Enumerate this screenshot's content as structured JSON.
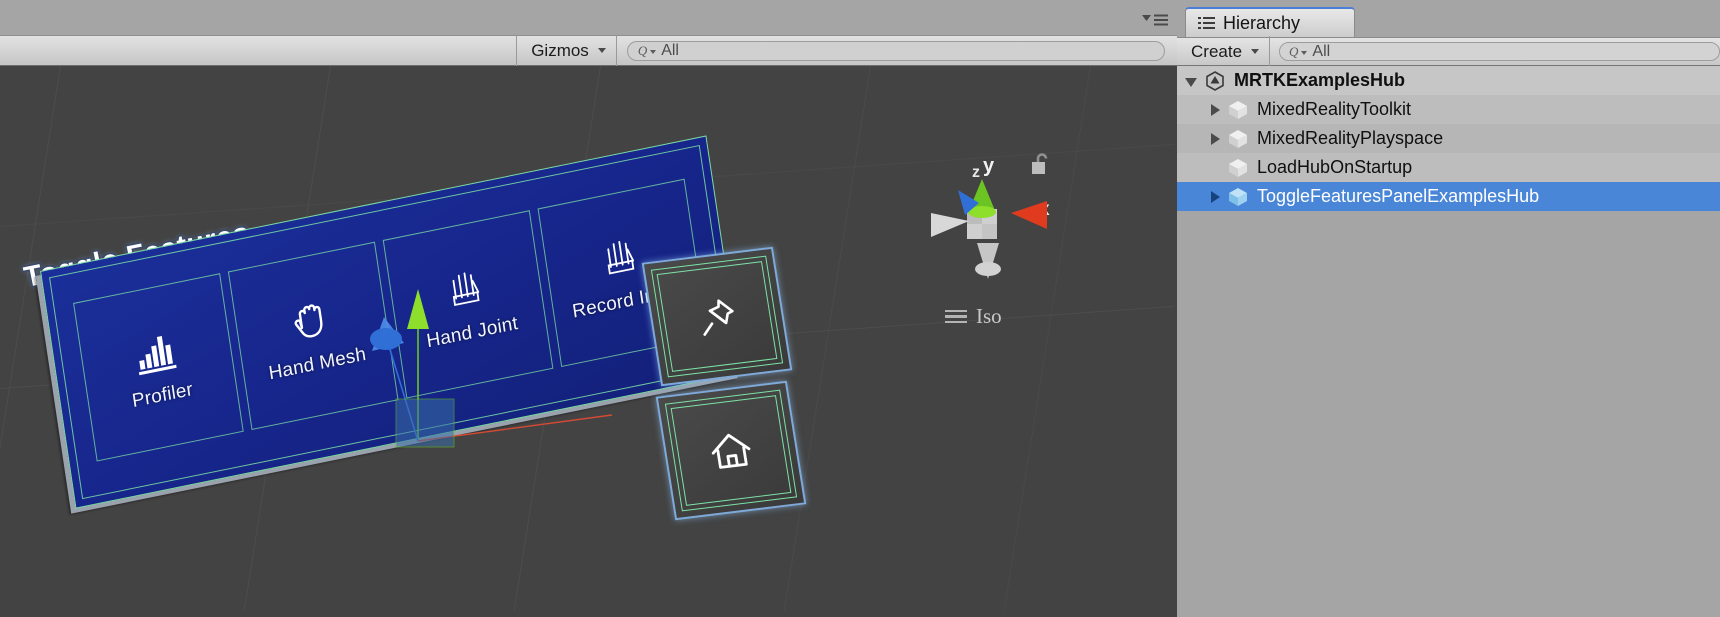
{
  "scene_view": {
    "options_icon": "options-menu-icon",
    "toolbar": {
      "gizmos_label": "Gizmos",
      "search_placeholder": "All",
      "search_icon": "search-icon"
    },
    "overlay": {
      "lock_icon": "unlocked-padlock-icon",
      "view_mode": "Iso",
      "view_mode_icon": "hamburger-icon",
      "axis_labels": {
        "x": "x",
        "y": "y",
        "z": "z"
      },
      "axis_colors": {
        "x": "#e03b1e",
        "y": "#6cc422",
        "z": "#2f6fd6",
        "neutral": "#c8c8c8"
      }
    },
    "background_color": "#434343",
    "grid_color": "#565656"
  },
  "mrtk_scene": {
    "panel_title": "Toggle Features",
    "panel_color": "#16258a",
    "wireframe_color": "#7de2a5",
    "selection_outline_color": "#7fa9d8",
    "buttons": [
      {
        "label": "Profiler",
        "icon": "bar-chart-icon"
      },
      {
        "label": "Hand Mesh",
        "icon": "hand-icon"
      },
      {
        "label": "Hand Joint",
        "icon": "hand-joint-icon"
      },
      {
        "label": "Record Input",
        "icon": "hand-record-icon"
      }
    ],
    "side_buttons": [
      {
        "name": "pin-button",
        "icon": "pin-icon"
      },
      {
        "name": "home-button",
        "icon": "home-icon"
      }
    ]
  },
  "hierarchy": {
    "tab_label": "Hierarchy",
    "tab_icon": "hierarchy-list-icon",
    "create_label": "Create",
    "search_placeholder": "All",
    "search_icon": "search-icon",
    "selection_color": "#4a86d8",
    "items": [
      {
        "label": "MRTKExamplesHub",
        "depth": 0,
        "expanded": true,
        "has_children": true,
        "icon": "unity-logo-icon",
        "selected": false,
        "bold": true
      },
      {
        "label": "MixedRealityToolkit",
        "depth": 1,
        "expanded": false,
        "has_children": true,
        "icon": "gameobject-cube-icon",
        "selected": false,
        "bold": false
      },
      {
        "label": "MixedRealityPlayspace",
        "depth": 1,
        "expanded": false,
        "has_children": true,
        "icon": "gameobject-cube-icon",
        "selected": false,
        "bold": false
      },
      {
        "label": "LoadHubOnStartup",
        "depth": 1,
        "expanded": false,
        "has_children": false,
        "icon": "gameobject-cube-icon",
        "selected": false,
        "bold": false
      },
      {
        "label": "ToggleFeaturesPanelExamplesHub",
        "depth": 1,
        "expanded": false,
        "has_children": true,
        "icon": "prefab-cube-icon",
        "selected": true,
        "bold": false
      }
    ]
  }
}
